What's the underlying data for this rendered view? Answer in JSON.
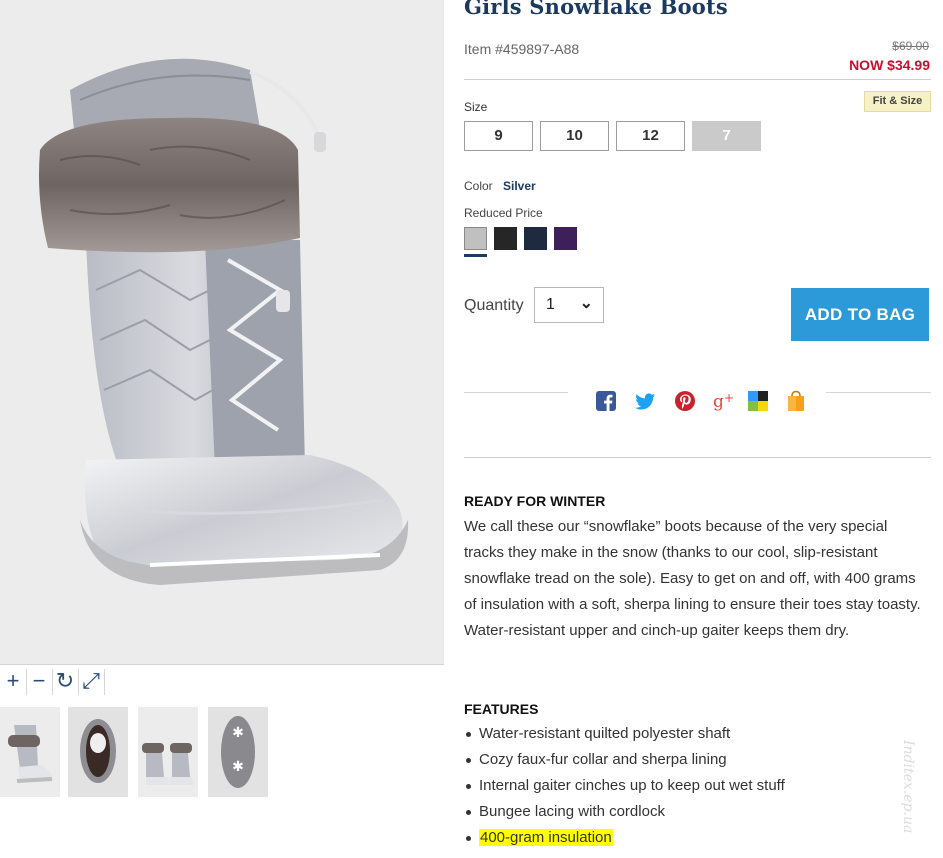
{
  "product": {
    "title": "Girls Snowflake Boots",
    "item_number": "Item #459897-A88",
    "was_price": "$69.00",
    "now_price": "NOW $34.99",
    "image_alt": "Girls silver quilted snow boot with faux-fur collar"
  },
  "gallery": {
    "controls": [
      {
        "name": "zoom-in",
        "glyph": "+"
      },
      {
        "name": "zoom-out",
        "glyph": "−"
      },
      {
        "name": "rotate",
        "glyph": "↻"
      },
      {
        "name": "fullscreen",
        "glyph": "⤢"
      }
    ],
    "thumbnails": [
      "front view",
      "top view",
      "pair view",
      "sole view"
    ]
  },
  "size": {
    "label": "Size",
    "fit_link": "Fit & Size",
    "options": [
      {
        "label": "9",
        "available": true
      },
      {
        "label": "10",
        "available": true
      },
      {
        "label": "12",
        "available": true
      },
      {
        "label": "7",
        "available": false
      }
    ]
  },
  "color": {
    "label": "Color",
    "selected": "Silver",
    "group_label": "Reduced Price",
    "swatches": [
      {
        "name": "silver",
        "hex": "#c0c0c0",
        "selected": true
      },
      {
        "name": "black",
        "hex": "#262626",
        "selected": false
      },
      {
        "name": "navy",
        "hex": "#1d2a3f",
        "selected": false
      },
      {
        "name": "purple",
        "hex": "#3d1f5a",
        "selected": false
      }
    ]
  },
  "quantity": {
    "label": "Quantity",
    "value": "1"
  },
  "cart": {
    "button_label": "ADD TO BAG"
  },
  "share": [
    "facebook-icon",
    "twitter-icon",
    "pinterest-icon",
    "google-plus-icon",
    "delicious-icon",
    "shopping-bag-icon"
  ],
  "description": {
    "heading": "READY FOR WINTER",
    "text": "We call these our “snowflake” boots because of the very special tracks they make in the snow (thanks to our cool, slip-resistant snowflake tread on the sole). Easy to get on and off, with 400 grams of insulation with a soft, sherpa lining to ensure their toes stay toasty. Water-resistant upper and cinch-up gaiter keeps them dry."
  },
  "features": {
    "heading": "FEATURES",
    "items": [
      "Water-resistant quilted polyester shaft",
      "Cozy faux-fur collar and sherpa lining",
      "Internal gaiter cinches up to keep out wet stuff",
      "Bungee lacing with cordlock",
      "400-gram insulation"
    ]
  },
  "watermark": "Inditex.ep.ua",
  "colors": {
    "title_navy": "#1c3a60",
    "sale_red": "#c8102e",
    "button_blue": "#2c9ad9",
    "highlight_yellow": "#ffff00"
  }
}
